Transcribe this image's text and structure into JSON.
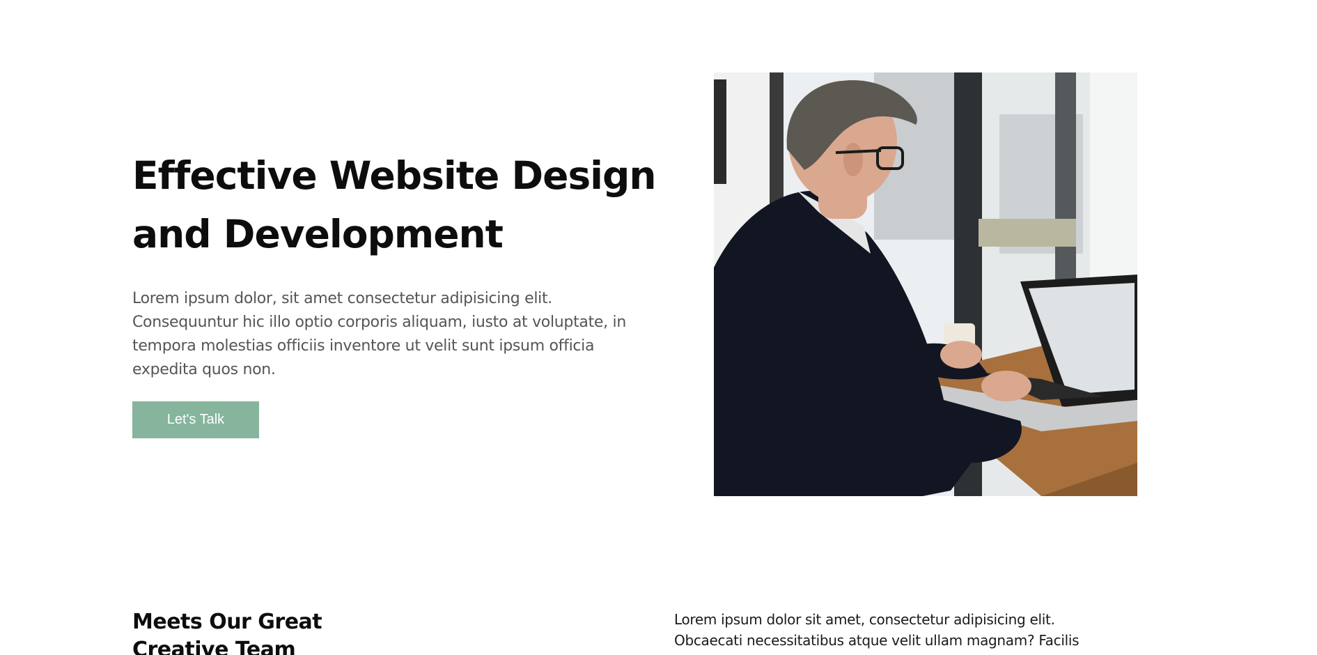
{
  "hero": {
    "title_line1": "Effective Website Design",
    "title_line2": "and Development",
    "description": "Lorem ipsum dolor, sit amet consectetur adipisicing elit. Consequuntur hic illo optio corporis aliquam, iusto at voluptate, in tempora molestias officiis inventore ut velit sunt ipsum officia expedita quos non.",
    "cta_label": "Let's Talk",
    "image_alt": "Man working on laptop in cafe"
  },
  "team": {
    "title": "Meets Our Great Creative Team",
    "description": "Lorem ipsum dolor sit amet, consectetur adipisicing elit. Obcaecati necessitatibus atque velit ullam magnam? Facilis"
  },
  "colors": {
    "accent": "#86b49d",
    "heading": "#0d0d0d",
    "body_text": "#555555"
  }
}
